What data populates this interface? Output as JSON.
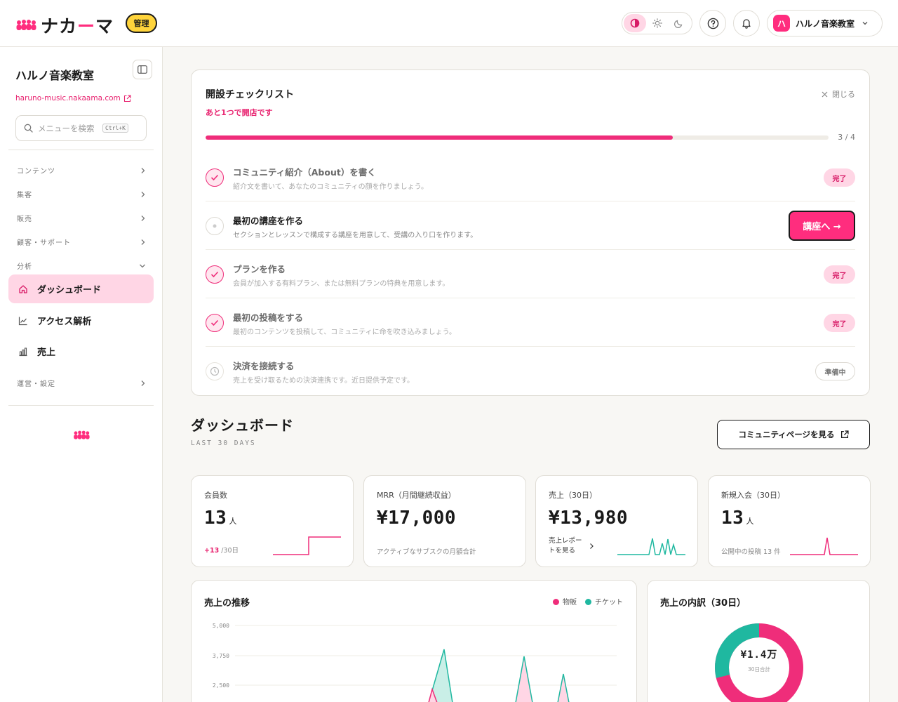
{
  "header": {
    "logo_text_a": "ナカ",
    "logo_text_dash": "ー",
    "logo_text_b": "マ",
    "admin_badge": "管理",
    "account_avatar": "ハ",
    "account_name": "ハルノ音楽教室"
  },
  "sidebar": {
    "title": "ハルノ音楽教室",
    "url": "haruno-music.nakaama.com",
    "search_placeholder": "メニューを検索",
    "search_shortcut": "Ctrl+K",
    "groups": {
      "contents": "コンテンツ",
      "marketing": "集客",
      "sales": "販売",
      "customers": "顧客・サポート",
      "analytics": "分析",
      "operations": "運営・設定"
    },
    "items": {
      "dashboard": "ダッシュボード",
      "access": "アクセス解析",
      "revenue": "売上"
    }
  },
  "checklist": {
    "title": "開設チェックリスト",
    "subtitle": "あと1つで開店です",
    "close_label": "閉じる",
    "progress_label": "3 / 4",
    "progress_done": 3,
    "progress_total": 4,
    "tasks": [
      {
        "title": "コミュニティ紹介（About）を書く",
        "desc": "紹介文を書いて、あなたのコミュニティの顔を作りましょう。",
        "status": "完了"
      },
      {
        "title": "最初の講座を作る",
        "desc": "セクションとレッスンで構成する講座を用意して、受講の入り口を作ります。",
        "action": "講座へ →"
      },
      {
        "title": "プランを作る",
        "desc": "会員が加入する有料プラン、または無料プランの特典を用意します。",
        "status": "完了"
      },
      {
        "title": "最初の投稿をする",
        "desc": "最初のコンテンツを投稿して、コミュニティに命を吹き込みましょう。",
        "status": "完了"
      },
      {
        "title": "決済を接続する",
        "desc": "売上を受け取るための決済連携です。近日提供予定です。",
        "status": "準備中"
      }
    ]
  },
  "dashboard": {
    "title": "ダッシュボード",
    "subtitle": "LAST 30 DAYS",
    "community_button": "コミュニティページを見る"
  },
  "kpis": [
    {
      "label": "会員数",
      "value": "13",
      "unit": "人",
      "delta": "+13",
      "delta_suffix": "/30日"
    },
    {
      "label": "MRR（月間継続収益）",
      "value": "¥17,000",
      "foot": "アクティブなサブスクの月額合計"
    },
    {
      "label": "売上（30日）",
      "value": "¥13,980",
      "link": "売上レポートを見る"
    },
    {
      "label": "新規入会（30日）",
      "value": "13",
      "unit": "人",
      "foot": "公開中の投稿 13 件"
    }
  ],
  "trend": {
    "title": "売上の推移",
    "legend": [
      {
        "name": "物販",
        "color": "#ef2d7a"
      },
      {
        "name": "チケット",
        "color": "#1fb8a0"
      }
    ],
    "ticks": [
      "5,000",
      "3,750",
      "2,500"
    ]
  },
  "breakdown": {
    "title": "売上の内訳（30日）",
    "center_value": "¥1.4万",
    "center_caption": "30日合計"
  },
  "colors": {
    "accent": "#ef2d7a",
    "teal": "#1fb8a0",
    "badge_yellow": "#ffd43b"
  }
}
